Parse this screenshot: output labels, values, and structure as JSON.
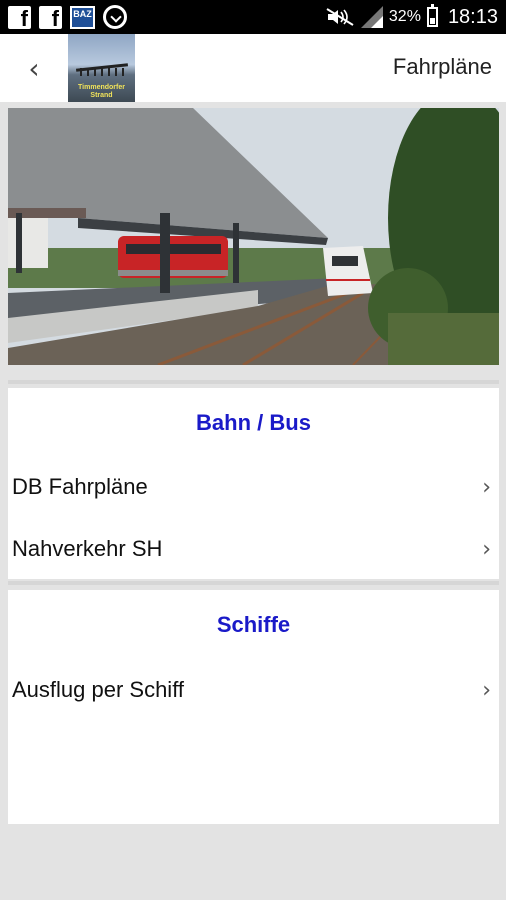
{
  "statusbar": {
    "icons": [
      "facebook-icon",
      "facebook-icon",
      "baz-app-icon",
      "sync-icon",
      "mute-icon",
      "signal-icon",
      "battery-icon"
    ],
    "baz_label": "BAZ",
    "battery": "32%",
    "time": "18:13"
  },
  "appbar": {
    "back_icon": "‹",
    "logo_text": "Timmendorfer Strand",
    "title": "Fahrpläne"
  },
  "sections": [
    {
      "heading": "Bahn / Bus",
      "items": [
        {
          "label": "DB Fahrpläne",
          "chevron": "›"
        },
        {
          "label": "Nahverkehr SH",
          "chevron": "›"
        }
      ]
    },
    {
      "heading": "Schiffe",
      "items": [
        {
          "label": "Ausflug per Schiff",
          "chevron": "›"
        }
      ]
    }
  ],
  "colors": {
    "heading": "#1a1ac8",
    "background": "#e3e3e3",
    "statusbar": "#000000"
  }
}
